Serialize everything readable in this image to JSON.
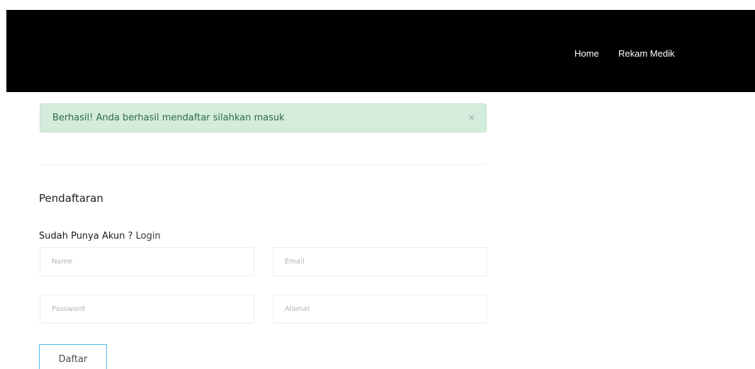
{
  "navbar": {
    "links": [
      {
        "label": "Home"
      },
      {
        "label": "Rekam Medik"
      }
    ]
  },
  "alert": {
    "message": "Berhasil! Anda berhasil mendaftar silahkan masuk",
    "close_symbol": "×",
    "background_color": "#d3ecdc",
    "text_color": "#2f6a43"
  },
  "form": {
    "title": "Pendaftaran",
    "account_prompt": "Sudah Punya Akun ?",
    "login_link": "Login",
    "fields": {
      "name": {
        "placeholder": "Name",
        "value": ""
      },
      "email": {
        "placeholder": "Email",
        "value": ""
      },
      "password": {
        "placeholder": "Password",
        "value": ""
      },
      "alamat": {
        "placeholder": "Alamat",
        "value": ""
      }
    },
    "submit_label": "Daftar",
    "submit_border_color": "#52b7ea"
  }
}
